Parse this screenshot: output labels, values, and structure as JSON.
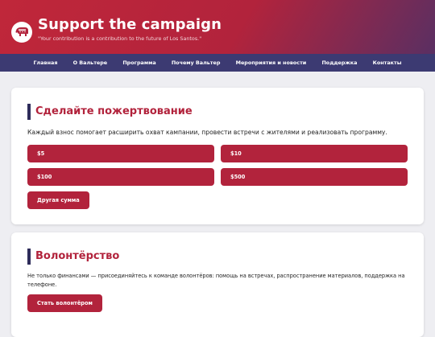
{
  "header": {
    "title": "Support the campaign",
    "tagline": "\"Your contribution is a contribution to the future of Los Santos.\"",
    "logo_icon": "elephant-icon"
  },
  "nav": {
    "items": [
      {
        "label": "Главная"
      },
      {
        "label": "О Вальтере"
      },
      {
        "label": "Программа"
      },
      {
        "label": "Почему Вальтер"
      },
      {
        "label": "Мероприятия и новости"
      },
      {
        "label": "Поддержка"
      },
      {
        "label": "Контакты"
      }
    ]
  },
  "donate": {
    "title": "Сделайте пожертвование",
    "description": "Каждый взнос помогает расширить охват кампании, провести встречи с жителями и реализовать программу.",
    "amounts": [
      "$5",
      "$10",
      "$100",
      "$500"
    ],
    "other_label": "Другая сумма"
  },
  "volunteer": {
    "title": "Волонтёрство",
    "description": "Не только финансами — присоединяйтесь к команде волонтёров: помощь на встречах, распространение материалов, поддержка на телефоне.",
    "button_label": "Стать волонтёром"
  },
  "colors": {
    "accent": "#b2233c",
    "nav": "#3c3a72",
    "background": "#eeeef2"
  }
}
